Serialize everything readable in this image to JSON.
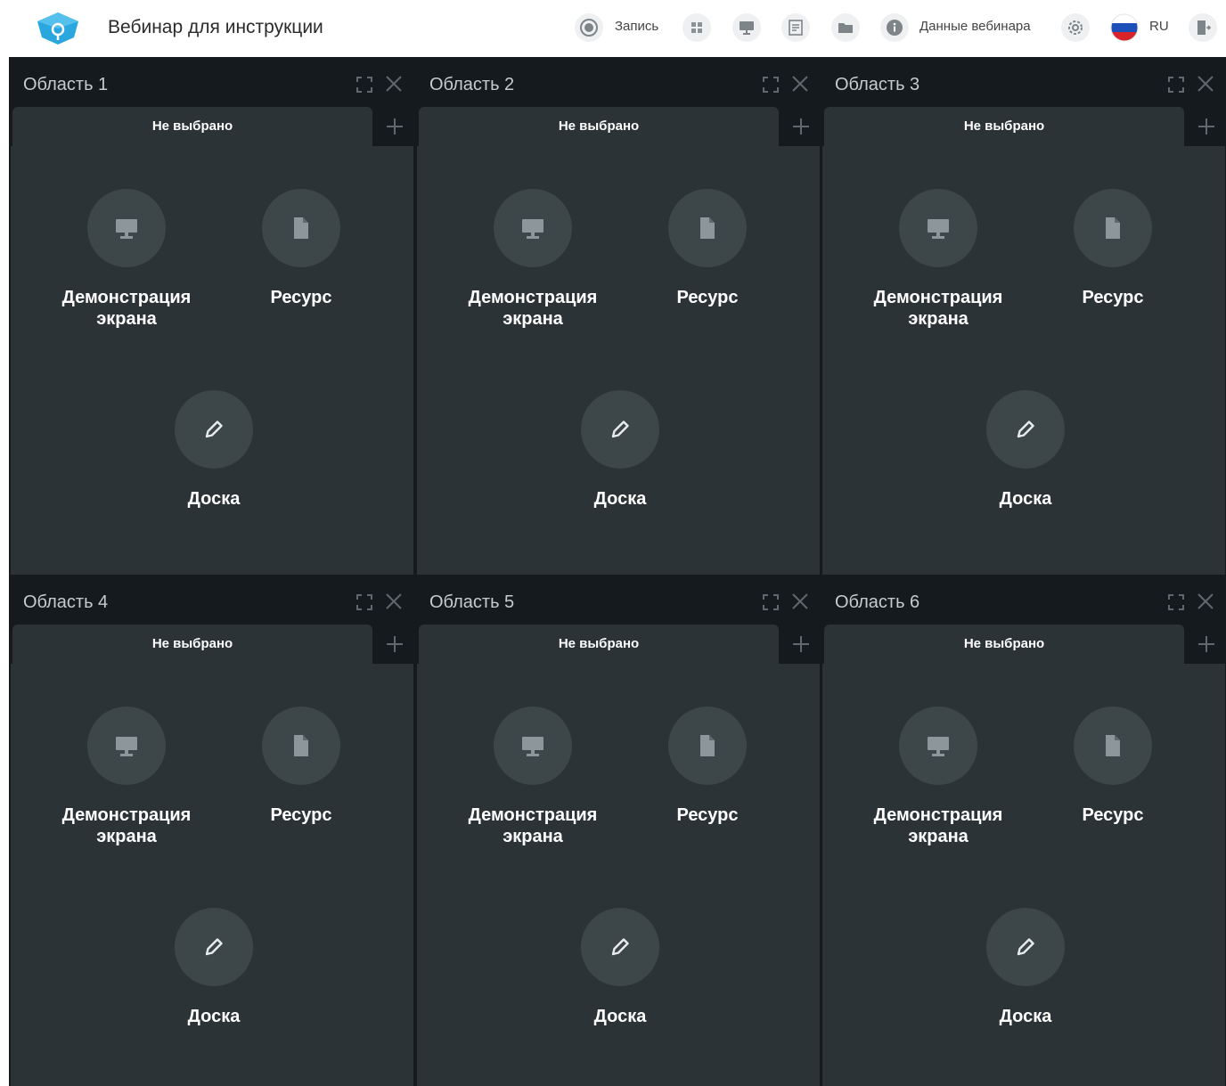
{
  "header": {
    "title": "Вебинар для инструкции",
    "record_label": "Запись",
    "webinar_data_label": "Данные вебинара",
    "language_label": "RU"
  },
  "colors": {
    "accent": "#2aa7de",
    "background": "#141a1d",
    "panel": "#2b3337",
    "circle": "#3d4649"
  },
  "areas": [
    {
      "title": "Область 1",
      "tab_label": "Не выбрано",
      "option_screen": "Демонстрация экрана",
      "option_resource": "Ресурс",
      "option_board": "Доска"
    },
    {
      "title": "Область 2",
      "tab_label": "Не выбрано",
      "option_screen": "Демонстрация экрана",
      "option_resource": "Ресурс",
      "option_board": "Доска"
    },
    {
      "title": "Область 3",
      "tab_label": "Не выбрано",
      "option_screen": "Демонстрация экрана",
      "option_resource": "Ресурс",
      "option_board": "Доска"
    },
    {
      "title": "Область 4",
      "tab_label": "Не выбрано",
      "option_screen": "Демонстрация экрана",
      "option_resource": "Ресурс",
      "option_board": "Доска"
    },
    {
      "title": "Область 5",
      "tab_label": "Не выбрано",
      "option_screen": "Демонстрация экрана",
      "option_resource": "Ресурс",
      "option_board": "Доска"
    },
    {
      "title": "Область 6",
      "tab_label": "Не выбрано",
      "option_screen": "Демонстрация экрана",
      "option_resource": "Ресурс",
      "option_board": "Доска"
    }
  ]
}
